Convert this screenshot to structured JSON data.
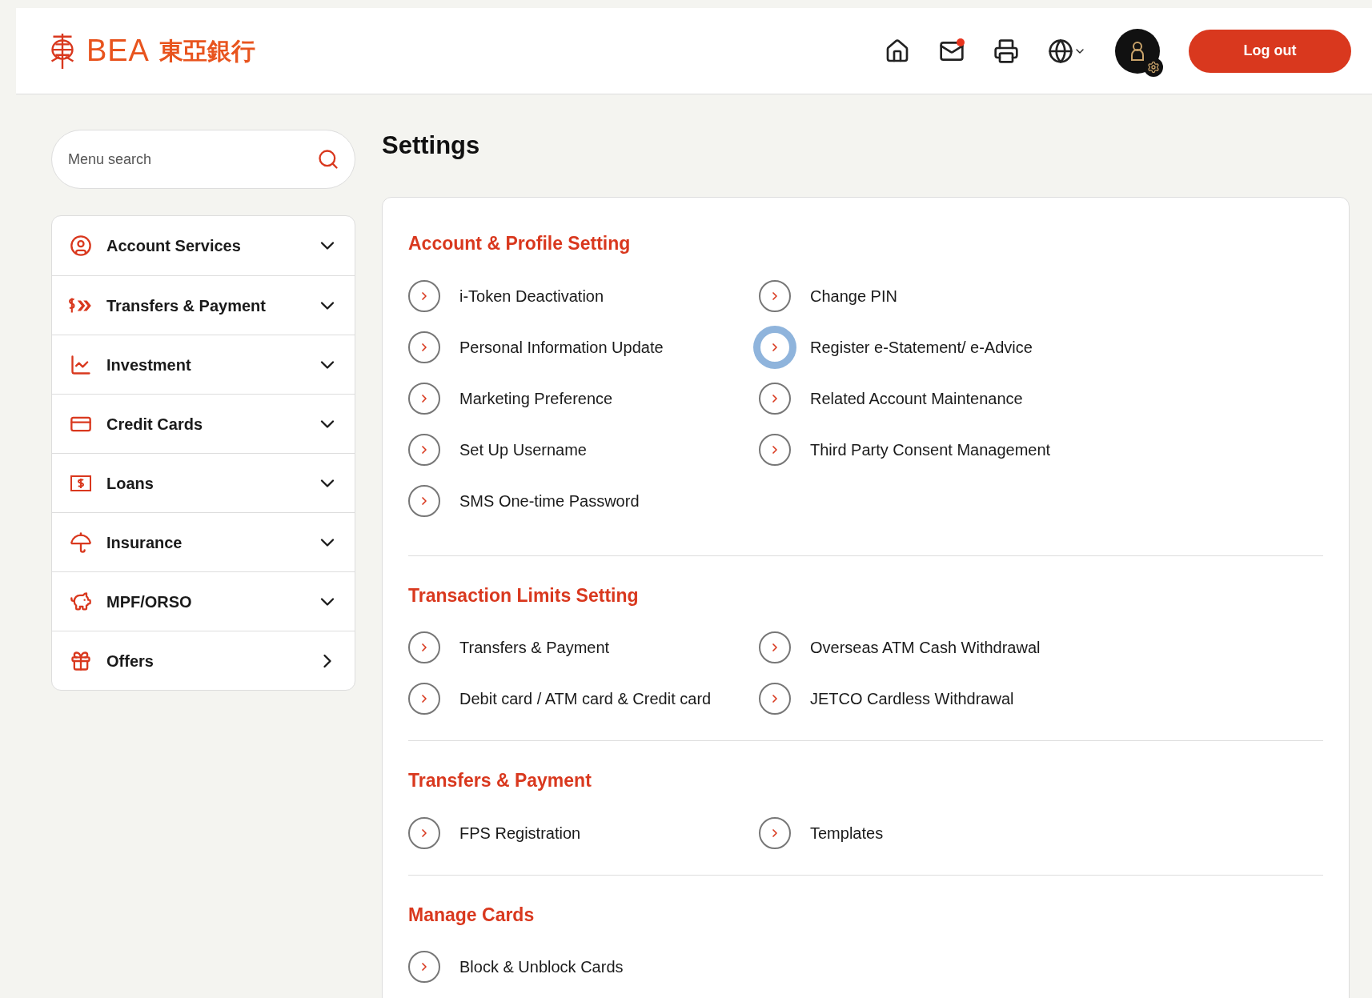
{
  "header": {
    "logo_text": "BEA",
    "logo_chinese": "東亞銀行",
    "mail_unread": true,
    "logout": "Log out"
  },
  "search": {
    "placeholder": "Menu search"
  },
  "menu": [
    {
      "label": "Account Services",
      "kind": "group"
    },
    {
      "label": "Transfers & Payment",
      "kind": "group"
    },
    {
      "label": "Investment",
      "kind": "group"
    },
    {
      "label": "Credit Cards",
      "kind": "group"
    },
    {
      "label": "Loans",
      "kind": "group"
    },
    {
      "label": "Insurance",
      "kind": "group"
    },
    {
      "label": "MPF/ORSO",
      "kind": "group"
    },
    {
      "label": "Offers",
      "kind": "link"
    }
  ],
  "page_title": "Settings",
  "sections": [
    {
      "title": "Account & Profile Setting",
      "items": [
        {
          "label": "i-Token Deactivation",
          "focused": false
        },
        {
          "label": "Change PIN",
          "focused": false
        },
        {
          "label": "Personal Information Update",
          "focused": false
        },
        {
          "label": "Register e-Statement/ e-Advice",
          "focused": true
        },
        {
          "label": "Marketing Preference",
          "focused": false
        },
        {
          "label": "Related Account Maintenance",
          "focused": false
        },
        {
          "label": "Set Up Username",
          "focused": false
        },
        {
          "label": "Third Party Consent Management",
          "focused": false
        },
        {
          "label": "SMS One-time Password",
          "focused": false
        }
      ]
    },
    {
      "title": "Transaction Limits Setting",
      "items": [
        {
          "label": "Transfers & Payment",
          "focused": false
        },
        {
          "label": "Overseas ATM Cash Withdrawal",
          "focused": false
        },
        {
          "label": "Debit card / ATM card & Credit card",
          "focused": false
        },
        {
          "label": "JETCO Cardless Withdrawal",
          "focused": false
        }
      ]
    },
    {
      "title": "Transfers & Payment",
      "items": [
        {
          "label": "FPS Registration",
          "focused": false
        },
        {
          "label": "Templates",
          "focused": false
        }
      ]
    },
    {
      "title": "Manage Cards",
      "items": [
        {
          "label": "Block & Unblock Cards",
          "focused": false
        }
      ]
    }
  ]
}
